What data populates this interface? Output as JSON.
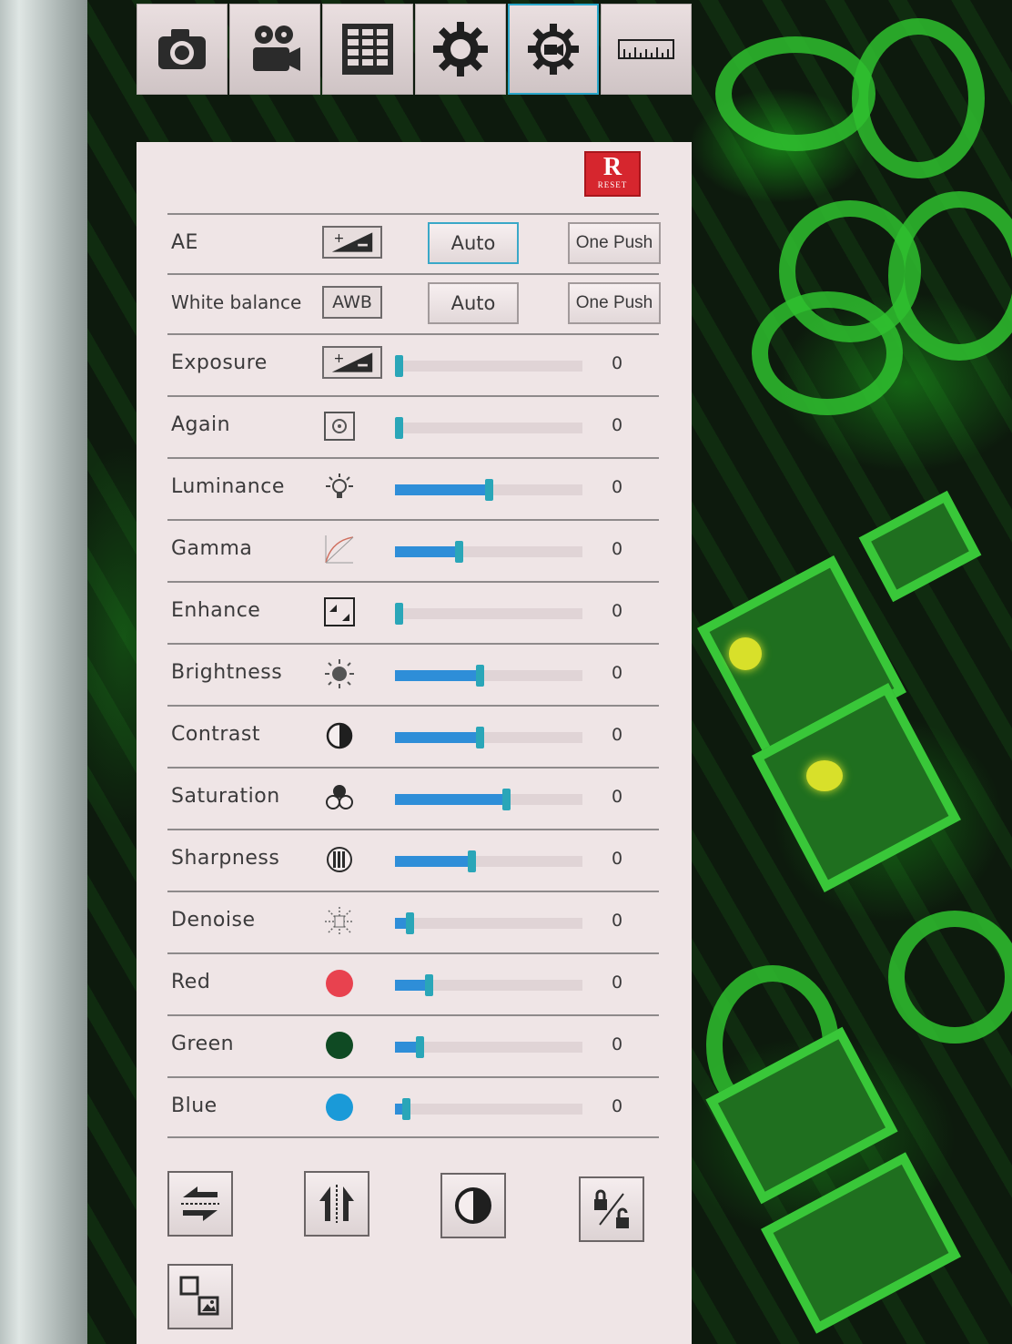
{
  "toolbar": {
    "tabs": [
      {
        "icon": "camera-icon"
      },
      {
        "icon": "video-camera-icon"
      },
      {
        "icon": "grid-icon"
      },
      {
        "icon": "gear-icon"
      },
      {
        "icon": "camera-settings-icon",
        "active": true
      },
      {
        "icon": "ruler-icon"
      }
    ]
  },
  "panel": {
    "reset": {
      "big": "R",
      "small": "RESET"
    },
    "ae": {
      "label": "AE",
      "auto": "Auto",
      "one_push": "One Push",
      "icon": "exposure-compensation-icon"
    },
    "white_balance": {
      "label": "White balance",
      "badge": "AWB",
      "auto": "Auto",
      "one_push": "One Push"
    },
    "sliders": [
      {
        "label": "Exposure",
        "icon": "exposure-compensation-icon",
        "level": 0.02,
        "value": "0"
      },
      {
        "label": "Again",
        "icon": "gain-icon",
        "level": 0.02,
        "value": "0"
      },
      {
        "label": "Luminance",
        "icon": "bulb-icon",
        "level": 0.5,
        "value": "0"
      },
      {
        "label": "Gamma",
        "icon": "gamma-curve-icon",
        "level": 0.34,
        "value": "0"
      },
      {
        "label": "Enhance",
        "icon": "enhance-icon",
        "level": 0.02,
        "value": "0"
      },
      {
        "label": "Brightness",
        "icon": "sun-icon",
        "level": 0.45,
        "value": "0"
      },
      {
        "label": "Contrast",
        "icon": "contrast-icon",
        "level": 0.45,
        "value": "0"
      },
      {
        "label": "Saturation",
        "icon": "color-circles-icon",
        "level": 0.59,
        "value": "0"
      },
      {
        "label": "Sharpness",
        "icon": "sharpness-icon",
        "level": 0.41,
        "value": "0"
      },
      {
        "label": "Denoise",
        "icon": "denoise-icon",
        "level": 0.08,
        "value": "0"
      },
      {
        "label": "Red",
        "icon": "red-dot-icon",
        "color": "#e8424f",
        "level": 0.18,
        "value": "0"
      },
      {
        "label": "Green",
        "icon": "green-dot-icon",
        "color": "#0f4a23",
        "level": 0.13,
        "value": "0"
      },
      {
        "label": "Blue",
        "icon": "blue-dot-icon",
        "color": "#1a9ad8",
        "level": 0.06,
        "value": "0"
      }
    ],
    "bottom_buttons": [
      {
        "icon": "flip-vertical-icon"
      },
      {
        "icon": "flip-horizontal-icon"
      },
      {
        "icon": "contrast-invert-icon"
      },
      {
        "icon": "lock-unlock-icon"
      },
      {
        "icon": "picture-in-picture-icon"
      }
    ]
  },
  "colors": {
    "panel_bg": "#efe5e6",
    "slider_fill": "#2e8ed8",
    "slider_thumb": "#2aa6b8",
    "reset_red": "#d6262e",
    "active_border": "#2aa6c9"
  }
}
